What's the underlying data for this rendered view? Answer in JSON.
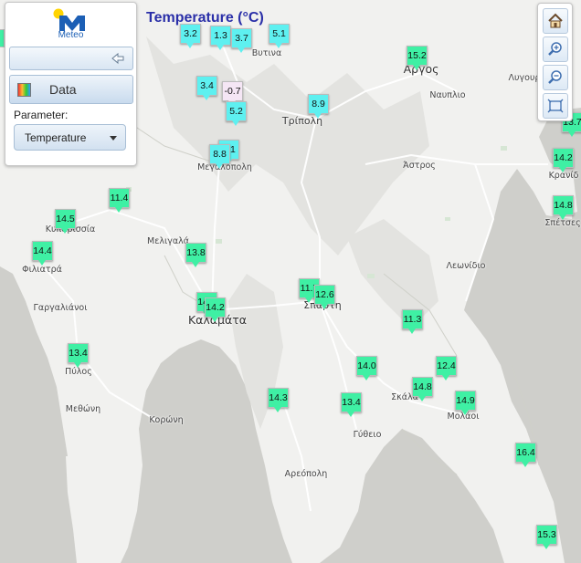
{
  "title": "Temperature (°C)",
  "logo": {
    "text": "Meteo",
    "colors": {
      "blue": "#1c5fb5",
      "yellow": "#ffd400"
    }
  },
  "panel": {
    "data_label": "Data",
    "parameter_label": "Parameter:",
    "parameter_value": "Temperature"
  },
  "colors": {
    "cold_cyan": "#5ef0f0",
    "neutral_green": "#3ff0a4",
    "freezing_pink": "#f5e6f5",
    "title_blue": "#2a2fa8",
    "land": "#f1f1ef",
    "sea": "#cfcfcb"
  },
  "places": [
    "Βυτινα",
    "Αργος",
    "Λυγουρ",
    "Ναυπλιο",
    "Τρίπολη",
    "Κρανίδ",
    "Μεγαλόπολη",
    "Άστρος",
    "Σπέτσες",
    "Κυπαρισσία",
    "Μελιγαλά",
    "Φιλιατρά",
    "Λεωνίδιο",
    "Γαργαλιάνοι",
    "Καλαμάτα",
    "Σπάρτη",
    "Πύλος",
    "Σκάλα",
    "Μεθώνη",
    "Μολάοι",
    "Κορώνη",
    "Γύθειο",
    "Αρεόπολη"
  ],
  "stations": [
    {
      "label": "3.2",
      "tone": "cold"
    },
    {
      "label": "1.3",
      "tone": "cold"
    },
    {
      "label": "3.7",
      "tone": "cold"
    },
    {
      "label": "5.1",
      "tone": "cold"
    },
    {
      "label": "15.2",
      "tone": "warm"
    },
    {
      "label": "3.4",
      "tone": "cold"
    },
    {
      "label": "-0.7",
      "tone": "freezing"
    },
    {
      "label": "5.2",
      "tone": "cold"
    },
    {
      "label": "8.9",
      "tone": "cold"
    },
    {
      "label": "7.1",
      "tone": "cold"
    },
    {
      "label": "8.8",
      "tone": "cold"
    },
    {
      "label": "13.7",
      "tone": "warm"
    },
    {
      "label": "14.2",
      "tone": "warm"
    },
    {
      "label": "14.8",
      "tone": "warm"
    },
    {
      "label": "11.4",
      "tone": "warm"
    },
    {
      "label": "14.5",
      "tone": "warm"
    },
    {
      "label": "14.4",
      "tone": "warm"
    },
    {
      "label": "13.8",
      "tone": "warm"
    },
    {
      "label": "11.7",
      "tone": "warm"
    },
    {
      "label": "12.6",
      "tone": "warm"
    },
    {
      "label": "14.3",
      "tone": "warm"
    },
    {
      "label": "14.2",
      "tone": "warm"
    },
    {
      "label": "11.3",
      "tone": "warm"
    },
    {
      "label": "13.4",
      "tone": "warm"
    },
    {
      "label": "14.0",
      "tone": "warm"
    },
    {
      "label": "12.4",
      "tone": "warm"
    },
    {
      "label": "14.8",
      "tone": "warm"
    },
    {
      "label": "14.9",
      "tone": "warm"
    },
    {
      "label": "14.3",
      "tone": "warm"
    },
    {
      "label": "13.4",
      "tone": "warm"
    },
    {
      "label": "16.4",
      "tone": "warm"
    },
    {
      "label": "15.3",
      "tone": "warm"
    }
  ],
  "toolbar": [
    "home-icon",
    "zoom-in-icon",
    "zoom-out-icon",
    "zoom-extent-icon"
  ]
}
